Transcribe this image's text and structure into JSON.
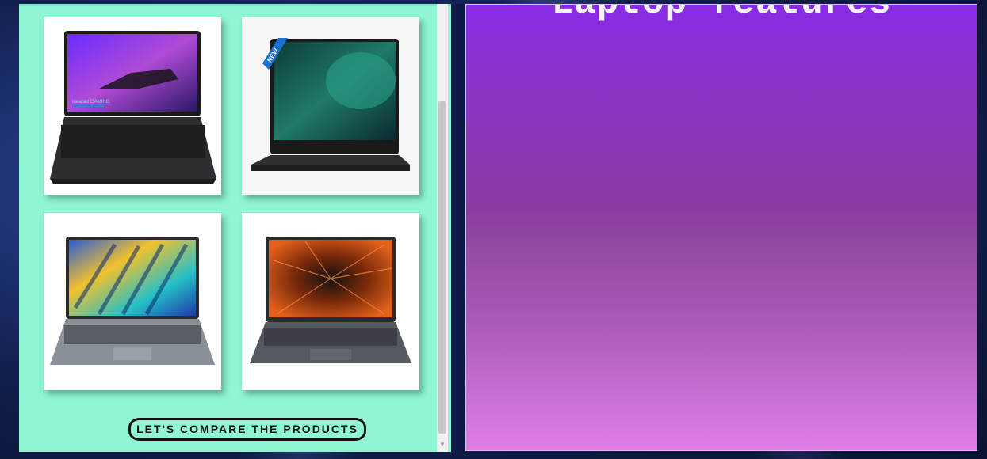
{
  "compare_button": {
    "label": "LET'S COMPARE THE PRODUCTS"
  },
  "features_panel": {
    "title": "Laptop features"
  },
  "products": [
    {
      "name": "laptop-product-1",
      "screen_label": "ideapad GAMING"
    },
    {
      "name": "laptop-product-2",
      "badge": "NEW"
    },
    {
      "name": "laptop-product-3"
    },
    {
      "name": "laptop-product-4"
    }
  ],
  "colors": {
    "left_panel_bg": "#8ff5d4",
    "right_panel_top": "#8a2be6",
    "right_panel_bottom": "#e07ee6",
    "page_bg": "#12204f"
  }
}
